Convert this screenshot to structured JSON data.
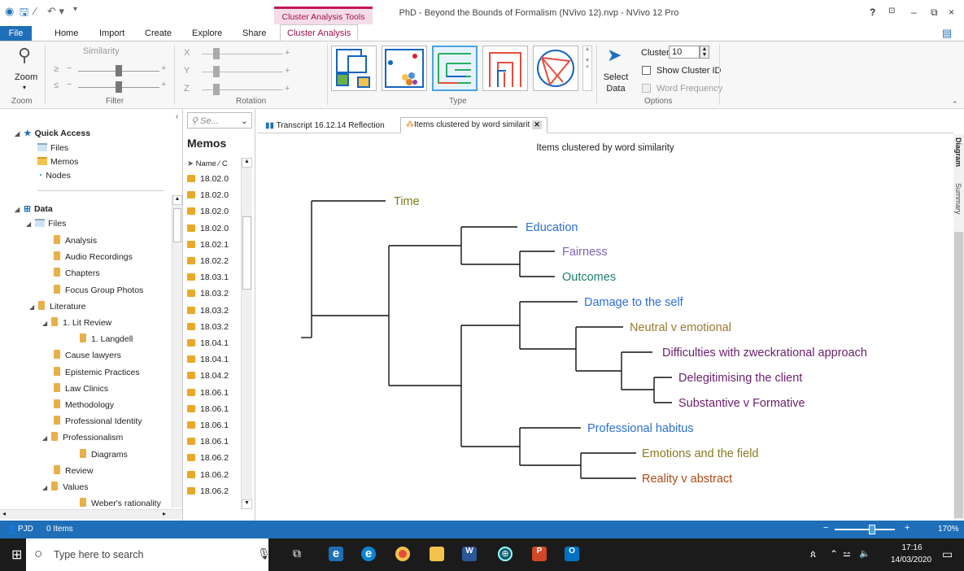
{
  "window": {
    "title": "PhD - Beyond the Bounds of Formalism (NVivo 12).nvp - NVivo 12 Pro",
    "context_tab": "Cluster Analysis Tools",
    "controls": [
      "?",
      "⊡",
      "–",
      "⧉",
      "×"
    ]
  },
  "ribbon_tabs": [
    "File",
    "Home",
    "Import",
    "Create",
    "Explore",
    "Share",
    "Cluster Analysis"
  ],
  "ribbon": {
    "zoom_label": "Zoom",
    "zoom_group": "Zoom",
    "similarity_label": "Similarity",
    "filter_group": "Filter",
    "ge_symbol": "≥",
    "le_symbol": "≤",
    "axis_x": "X",
    "axis_y": "Y",
    "axis_z": "Z",
    "rotation_group": "Rotation",
    "type_group": "Type",
    "select_data_line1": "Select",
    "select_data_line2": "Data",
    "clusters_label": "Clusters",
    "clusters_value": "10",
    "show_cluster_id": "Show Cluster ID",
    "word_frequency": "Word Frequency",
    "options_group": "Options"
  },
  "nav": {
    "quick_access": "Quick Access",
    "qa_items": [
      "Files",
      "Memos",
      "Nodes"
    ],
    "data": "Data",
    "files": "Files",
    "folders": [
      {
        "label": "Analysis",
        "level": 2
      },
      {
        "label": "Audio Recordings",
        "level": 2
      },
      {
        "label": "Chapters",
        "level": 2
      },
      {
        "label": "Focus Group Photos",
        "level": 2
      },
      {
        "label": "Literature",
        "level": 1,
        "expanded": true
      },
      {
        "label": "1. Lit Review",
        "level": 2,
        "expanded": true
      },
      {
        "label": "1. Langdell",
        "level": 3
      },
      {
        "label": "Cause lawyers",
        "level": 2
      },
      {
        "label": "Epistemic Practices",
        "level": 2
      },
      {
        "label": "Law Clinics",
        "level": 2
      },
      {
        "label": "Methodology",
        "level": 2
      },
      {
        "label": "Professional Identity",
        "level": 2
      },
      {
        "label": "Professionalism",
        "level": 2,
        "expanded": true
      },
      {
        "label": "Diagrams",
        "level": 3
      },
      {
        "label": "Review",
        "level": 2
      },
      {
        "label": "Values",
        "level": 2,
        "expanded": true
      },
      {
        "label": "Weber's rationality",
        "level": 3
      }
    ]
  },
  "memos": {
    "search_placeholder": "Se...",
    "heading": "Memos",
    "col_name": "Name",
    "col_sort": "∕",
    "col_c": "C",
    "rows": [
      "18.02.0",
      "18.02.0",
      "18.02.0",
      "18.02.0",
      "18.02.1",
      "18.02.2",
      "18.03.1",
      "18.03.2",
      "18.03.2",
      "18.03.2",
      "18.04.1",
      "18.04.1",
      "18.04.2",
      "18.06.1",
      "18.06.1",
      "18.06.1",
      "18.06.1",
      "18.06.2",
      "18.06.2",
      "18.06.2"
    ]
  },
  "doc_tabs": [
    {
      "label": "Transcript 16.12.14 Reflection",
      "active": false
    },
    {
      "label": "Items clustered by word similarit",
      "active": true
    }
  ],
  "diagram": {
    "title": "Items clustered by word similarity",
    "side_tabs": [
      "Diagram",
      "Summary"
    ],
    "leaves": [
      {
        "label": "Time",
        "color": "#7a7a1a"
      },
      {
        "label": "Education",
        "color": "#2b6fd6"
      },
      {
        "label": "Fairness",
        "color": "#7e64b5"
      },
      {
        "label": "Outcomes",
        "color": "#1c7f6d"
      },
      {
        "label": "Damage to the self",
        "color": "#2b6fd6"
      },
      {
        "label": "Neutral v emotional",
        "color": "#9a7a2e"
      },
      {
        "label": "Difficulties with zweckrational approach",
        "color": "#6b1f6b"
      },
      {
        "label": "Delegitimising the client",
        "color": "#6b1f6b"
      },
      {
        "label": "Substantive v Formative",
        "color": "#6b1f6b"
      },
      {
        "label": "Professional habitus",
        "color": "#2b6fd6"
      },
      {
        "label": "Emotions and the field",
        "color": "#8a7a22"
      },
      {
        "label": "Reality v abstract",
        "color": "#b04a14"
      }
    ]
  },
  "status": {
    "user": "PJD",
    "items": "0 Items",
    "zoom": "170%"
  },
  "taskbar": {
    "search": "Type here to search",
    "time": "17:16",
    "date": "14/03/2020"
  }
}
